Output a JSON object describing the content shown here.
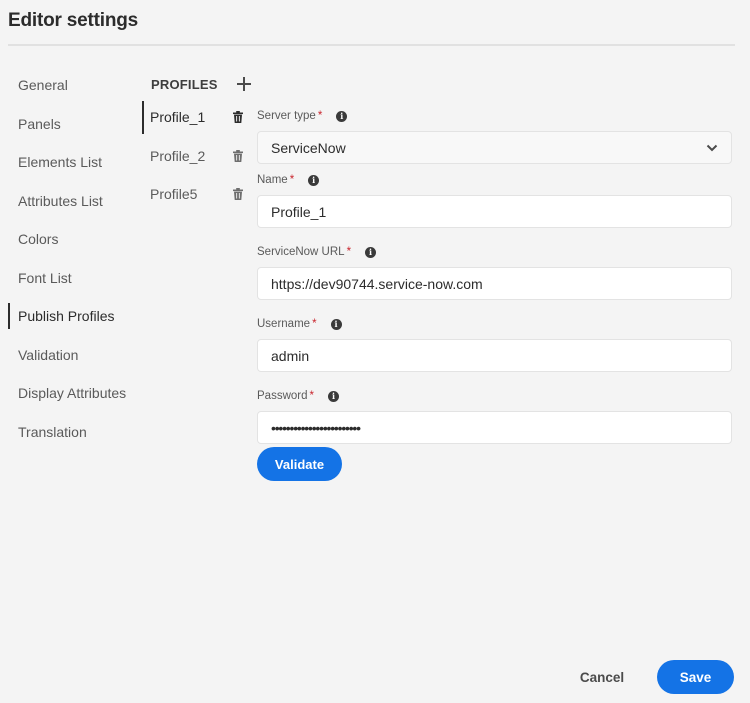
{
  "header": {
    "title": "Editor settings"
  },
  "sidebar": {
    "items": [
      {
        "label": "General",
        "active": false
      },
      {
        "label": "Panels",
        "active": false
      },
      {
        "label": "Elements List",
        "active": false
      },
      {
        "label": "Attributes List",
        "active": false
      },
      {
        "label": "Colors",
        "active": false
      },
      {
        "label": "Font List",
        "active": false
      },
      {
        "label": "Publish Profiles",
        "active": true
      },
      {
        "label": "Validation",
        "active": false
      },
      {
        "label": "Display Attributes",
        "active": false
      },
      {
        "label": "Translation",
        "active": false
      }
    ]
  },
  "profiles": {
    "title": "PROFILES",
    "add_icon": "plus-icon",
    "delete_icon": "trash-icon",
    "items": [
      {
        "name": "Profile_1",
        "active": true
      },
      {
        "name": "Profile_2",
        "active": false
      },
      {
        "name": "Profile5",
        "active": false
      }
    ]
  },
  "form": {
    "server_type": {
      "label": "Server type",
      "required": "*",
      "value": "ServiceNow",
      "info_icon": "info-icon"
    },
    "name": {
      "label": "Name",
      "required": "*",
      "value": "Profile_1",
      "info_icon": "info-icon"
    },
    "url": {
      "label": "ServiceNow URL",
      "required": "*",
      "value": "https://dev90744.service-now.com",
      "info_icon": "info-icon"
    },
    "username": {
      "label": "Username",
      "required": "*",
      "value": "admin",
      "info_icon": "info-icon"
    },
    "password": {
      "label": "Password",
      "required": "*",
      "masked_value": "••••••••••••••••••••••••",
      "info_icon": "info-icon"
    },
    "info_glyph": "i",
    "validate_label": "Validate"
  },
  "footer": {
    "cancel_label": "Cancel",
    "save_label": "Save"
  },
  "colors": {
    "accent": "#1473e6",
    "required": "#c9252d",
    "background": "#f4f4f4"
  }
}
